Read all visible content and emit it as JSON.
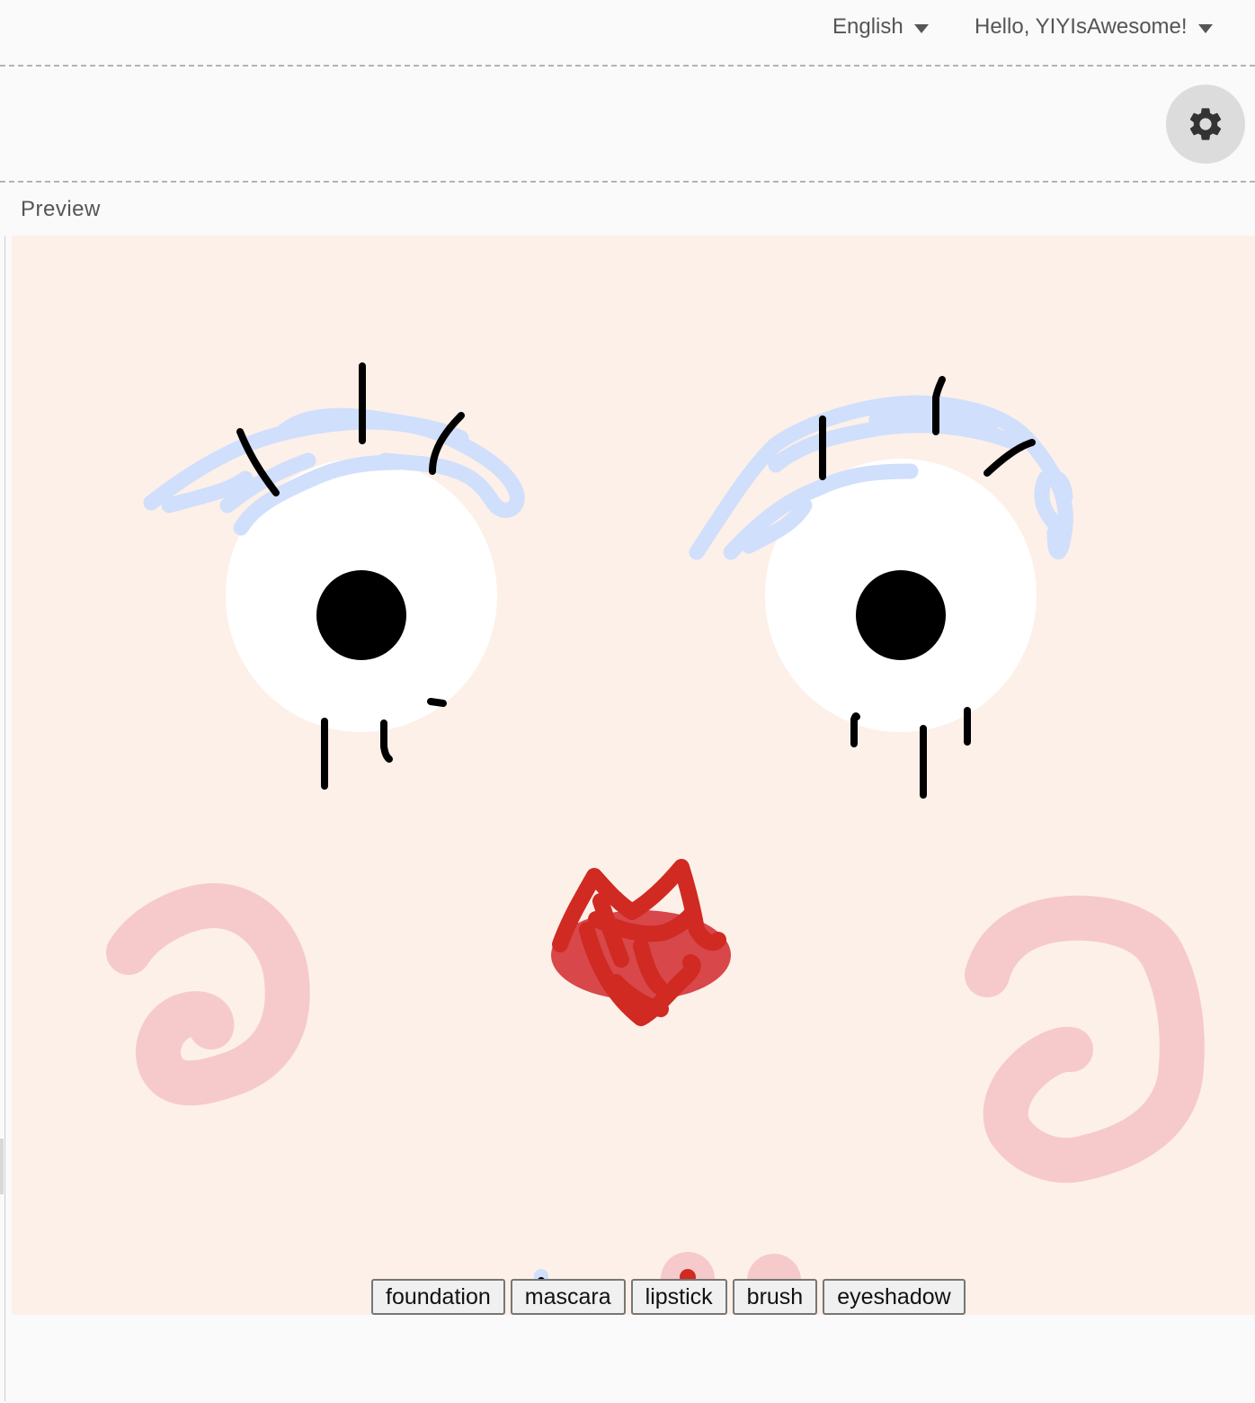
{
  "header": {
    "language": "English",
    "greeting": "Hello, YIYIsAwesome!"
  },
  "settings": {
    "icon": "gear-icon"
  },
  "preview": {
    "label": "Preview"
  },
  "canvas": {
    "skin_color": "#fdf0e8",
    "brow_color": "#d0dffb",
    "lash_color": "#000000",
    "lip_color": "#d02a22",
    "lip_shadow_color": "#d8474a",
    "blush_color": "#f6caca",
    "eye_white": "#ffffff",
    "pupil_color": "#000000"
  },
  "tools": [
    "foundation",
    "mascara",
    "lipstick",
    "brush",
    "eyeshadow"
  ]
}
